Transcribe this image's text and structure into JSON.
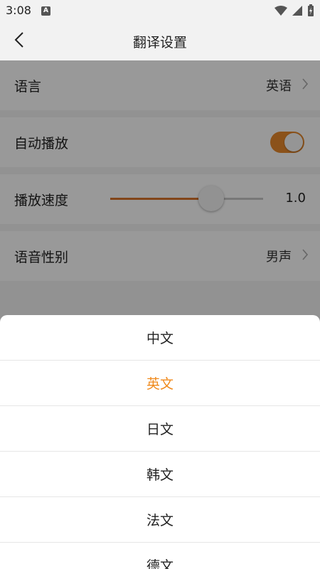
{
  "status_bar": {
    "time": "3:08",
    "notification_badge": "A",
    "icons": [
      "wifi-icon",
      "cell-signal-icon",
      "battery-charging-icon"
    ]
  },
  "app_bar": {
    "title": "翻译设置",
    "back_icon": "chevron-left-icon"
  },
  "settings": [
    {
      "label": "语言",
      "value": "英语",
      "type": "select"
    },
    {
      "label": "自动播放",
      "type": "toggle",
      "on": true
    },
    {
      "label": "播放速度",
      "type": "slider",
      "value": "1.0",
      "fill_fraction": 0.66
    },
    {
      "label": "语音性别",
      "value": "男声",
      "type": "select"
    }
  ],
  "language_sheet": {
    "options": [
      "中文",
      "英文",
      "日文",
      "韩文",
      "法文",
      "德文"
    ],
    "selected": "英文"
  },
  "colors": {
    "accent": "#f08a1c",
    "toggle_on": "#e8892c",
    "scrim": "rgba(0,0,0,0.4)"
  }
}
